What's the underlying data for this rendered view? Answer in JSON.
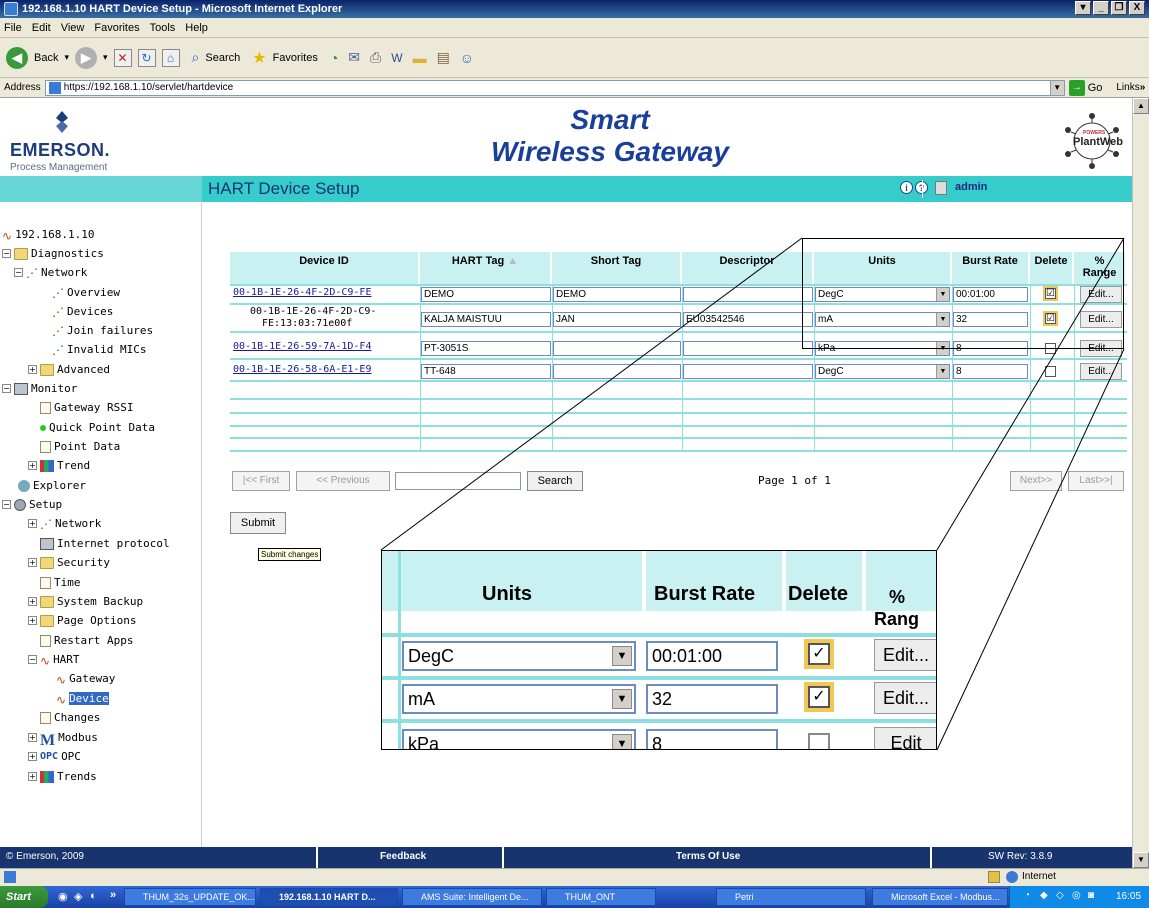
{
  "window": {
    "title": "192.168.1.10 HART Device Setup - Microsoft Internet Explorer",
    "min": "_",
    "max": "❐",
    "close": "X"
  },
  "menu": [
    "File",
    "Edit",
    "View",
    "Favorites",
    "Tools",
    "Help"
  ],
  "toolbar": {
    "back": "Back",
    "search": "Search",
    "favorites": "Favorites"
  },
  "address": {
    "label": "Address",
    "url": "https://192.168.1.10/servlet/hartdevice",
    "go": "Go",
    "links": "Links"
  },
  "brand": {
    "emerson": "EMERSON.",
    "emerson_sub": "Process Management",
    "title_line1": "Smart",
    "title_line2": "Wireless Gateway",
    "plantweb": "PlantWeb",
    "plantweb_top": "POWERS"
  },
  "header": {
    "section_title": "HART Device Setup",
    "user": "admin"
  },
  "sidebar": {
    "root": "192.168.1.10",
    "items": [
      "Diagnostics",
      "Network",
      "Overview",
      "Devices",
      "Join failures",
      "Invalid MICs",
      "Advanced",
      "Monitor",
      "Gateway RSSI",
      "Quick Point Data",
      "Point Data",
      "Trend",
      "Explorer",
      "Setup",
      "Network",
      "Internet protocol",
      "Security",
      "Time",
      "System Backup",
      "Page Options",
      "Restart Apps",
      "HART",
      "Gateway",
      "Device",
      "Changes",
      "Modbus",
      "OPC",
      "Trends"
    ]
  },
  "table": {
    "headers": [
      "Device ID",
      "HART Tag",
      "Short Tag",
      "Descriptor",
      "Units",
      "Burst Rate",
      "Delete",
      "%",
      "Range"
    ],
    "rows": [
      {
        "id": "00-1B-1E-26-4F-2D-C9-FE",
        "id2": "",
        "hart": "DEMO",
        "short": "DEMO",
        "desc": "",
        "units": "DegC",
        "burst": "00:01:00",
        "del": "☑",
        "edit": "Edit..."
      },
      {
        "id": "00-1B-1E-26-4F-2D-C9-",
        "id2": "FE:13:03:71e00f",
        "hart": "KALJA MAISTUU",
        "short": "JAN",
        "desc": "EU03542546",
        "units": "mA",
        "burst": "32",
        "del": "☑",
        "edit": "Edit..."
      },
      {
        "id": "00-1B-1E-26-59-7A-1D-F4",
        "id2": "",
        "hart": "PT-3051S",
        "short": "",
        "desc": "",
        "units": "kPa",
        "burst": "8",
        "del": "",
        "edit": "Edit..."
      },
      {
        "id": "00-1B-1E-26-58-6A-E1-E9",
        "id2": "",
        "hart": "TT-648",
        "short": "",
        "desc": "",
        "units": "DegC",
        "burst": "8",
        "del": "",
        "edit": "Edit..."
      }
    ]
  },
  "pager": {
    "first": "|<< First",
    "previous": "<< Previous",
    "search": "Search",
    "page": "Page 1 of 1",
    "next": "Next>>",
    "last": "Last>>|"
  },
  "submit": {
    "label": "Submit",
    "tooltip": "Submit changes"
  },
  "zoom": {
    "h_units": "Units",
    "h_burst": "Burst Rate",
    "h_delete": "Delete",
    "h_pct": "%",
    "h_range": "Rang",
    "r1_units": "DegC",
    "r1_burst": "00:01:00",
    "r1_edit": "Edit...",
    "r2_units": "mA",
    "r2_burst": "32",
    "r2_edit": "Edit...",
    "r3_units": "kPa",
    "r3_burst": "8",
    "r3_edit": "Edit"
  },
  "footer": {
    "copyright": "© Emerson, 2009",
    "feedback": "Feedback",
    "terms": "Terms Of Use",
    "swrev": "SW Rev: 3.8.9"
  },
  "status": {
    "zone": "Internet"
  },
  "taskbar": {
    "start": "Start",
    "tasks": [
      "THUM_32s_UPDATE_OK....",
      "192.168.1.10 HART D...",
      "AMS Suite: Intelligent De...",
      "THUM_ONT",
      "Petri",
      "Microsoft Excel - Modbus..."
    ],
    "clock": "16:05"
  }
}
